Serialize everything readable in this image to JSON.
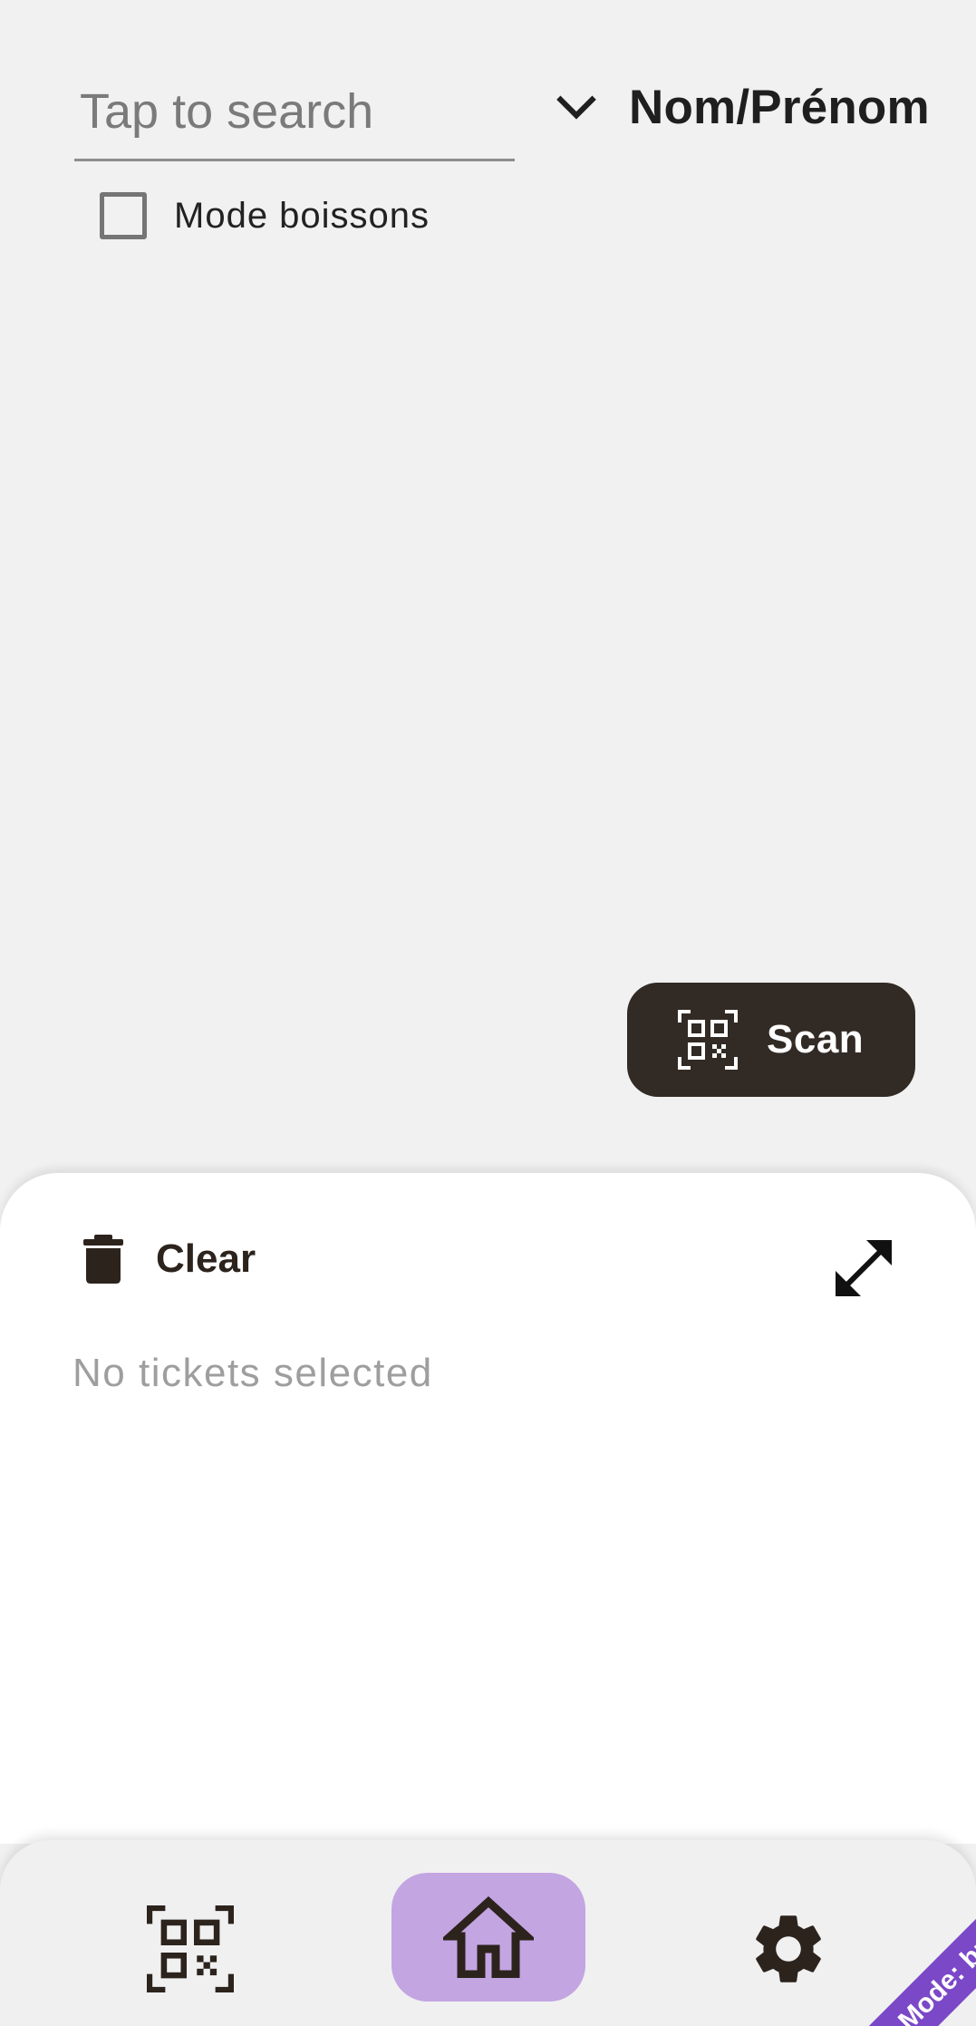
{
  "search": {
    "placeholder": "Tap to search",
    "value": ""
  },
  "sort": {
    "selected": "Nom/Prénom",
    "icon": "chevron-down-icon"
  },
  "drink_mode": {
    "label": "Mode boissons",
    "checked": false
  },
  "fab": {
    "label": "Scan",
    "icon": "qr-code-scan-icon"
  },
  "sheet": {
    "clear_label": "Clear",
    "clear_icon": "trash-icon",
    "expand_icon": "expand-icon",
    "empty_message": "No tickets selected"
  },
  "nav": {
    "items": [
      {
        "id": "scan",
        "icon": "qr-code-icon",
        "selected": false
      },
      {
        "id": "home",
        "icon": "home-icon",
        "selected": true
      },
      {
        "id": "settings",
        "icon": "gear-icon",
        "selected": false
      }
    ]
  },
  "mode_ribbon": {
    "label": "Mode: buy"
  },
  "colors": {
    "background": "#f1f1f1",
    "fab": "#322a24",
    "nav_selected": "#c3a5e2",
    "ribbon": "#7b48c8",
    "sheet": "#ffffff"
  }
}
